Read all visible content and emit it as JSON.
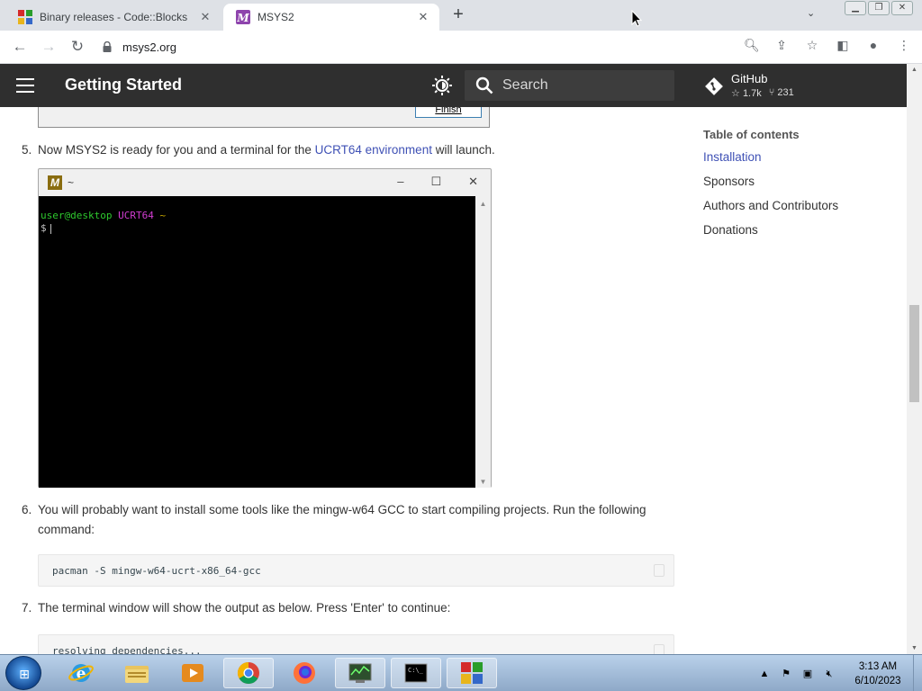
{
  "browser": {
    "tabs": [
      {
        "title": "Binary releases - Code::Blocks",
        "active": false,
        "favicon": "codeblocks-icon"
      },
      {
        "title": "MSYS2",
        "active": true,
        "favicon": "msys2-icon"
      }
    ],
    "url": "msys2.org"
  },
  "header": {
    "title": "Getting Started",
    "search_placeholder": "Search",
    "repo": {
      "name": "GitHub",
      "stars": "1.7k",
      "forks": "231"
    }
  },
  "content": {
    "finish_button": "Finish",
    "step5": {
      "num": "5.",
      "text_before": "Now MSYS2 is ready for you and a terminal for the ",
      "link": "UCRT64 environment",
      "text_after": " will launch."
    },
    "terminal": {
      "title": "~",
      "user_host": "user@desktop",
      "env": "UCRT64",
      "path": "~",
      "prompt": "$"
    },
    "step6": {
      "num": "6.",
      "line1": "You will probably want to install some tools like the mingw-w64 GCC to start compiling projects. Run the following",
      "line2": "command:"
    },
    "command1": "pacman -S mingw-w64-ucrt-x86_64-gcc",
    "step7": {
      "num": "7.",
      "text": "The terminal window will show the output as below. Press 'Enter' to continue:"
    },
    "command2": "resolving dependencies..."
  },
  "toc": {
    "title": "Table of contents",
    "items": [
      "Installation",
      "Sponsors",
      "Authors and Contributors",
      "Donations"
    ],
    "active_index": 0
  },
  "taskbar": {
    "apps": [
      "internet-explorer-icon",
      "file-explorer-icon",
      "media-player-icon",
      "chrome-icon",
      "firefox-icon",
      "system-monitor-icon",
      "command-prompt-icon",
      "codeblocks-icon"
    ],
    "time": "3:13 AM",
    "date": "6/10/2023"
  },
  "colors": {
    "header_bg": "#2f2f2f",
    "link": "#3f51b5",
    "terminal_green": "#2ec92e",
    "terminal_magenta": "#d33dd3"
  }
}
